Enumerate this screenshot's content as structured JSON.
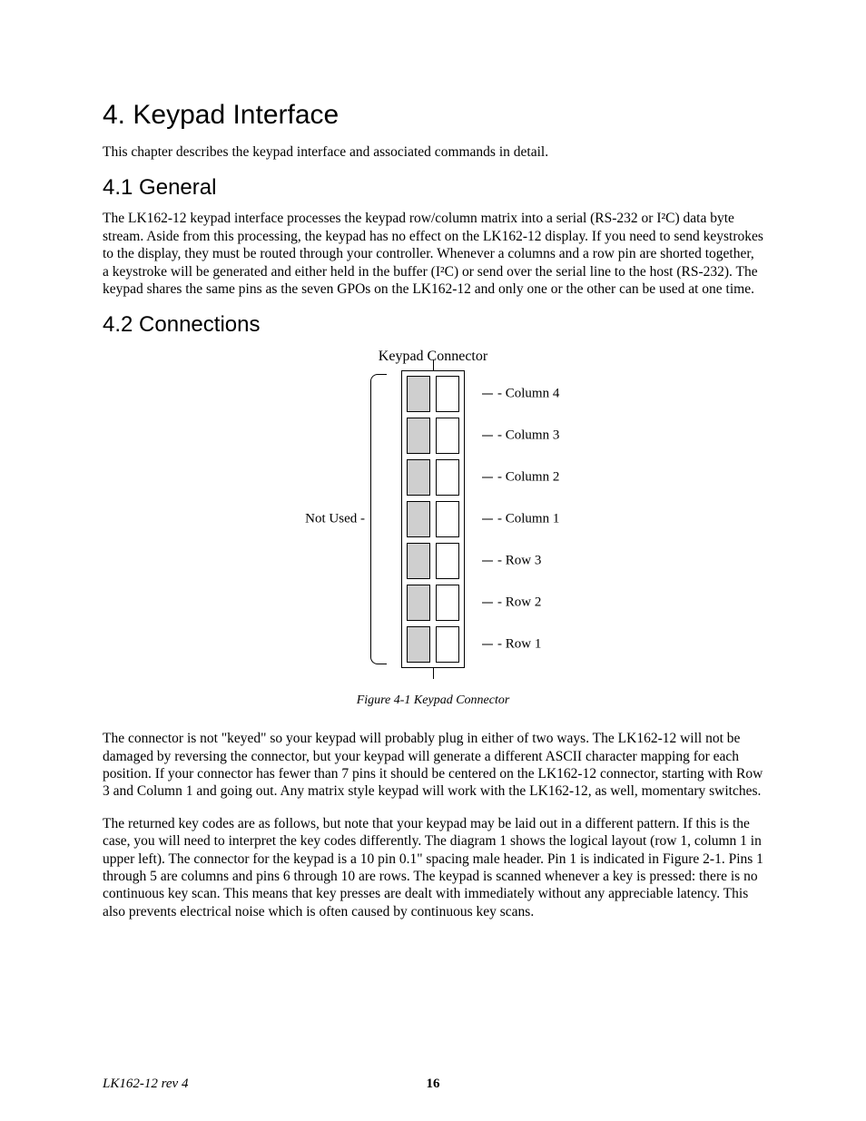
{
  "chapter": {
    "number": "4.",
    "title": "Keypad Interface"
  },
  "intro": "This chapter describes the keypad interface and associated commands in detail.",
  "sections": {
    "s41": {
      "number": "4.1",
      "title": "General"
    },
    "s42": {
      "number": "4.2",
      "title": "Connections"
    }
  },
  "general_text": "The LK162-12 keypad interface processes the keypad row/column matrix into a serial (RS-232 or I²C) data byte stream. Aside from this processing, the keypad has no effect on the LK162-12 display. If you need to send keystrokes to the display, they must be routed through your controller. Whenever a columns and a row pin are shorted together, a keystroke will be generated and either held in the buffer (I²C) or send over the serial line to the host (RS-232). The keypad shares the same pins as the seven GPOs on the LK162-12 and only one or the other can be used at one time.",
  "diagram": {
    "title": "Keypad Connector",
    "left_label": "Not Used -",
    "pins": [
      {
        "label": "Column 4"
      },
      {
        "label": "Column 3"
      },
      {
        "label": "Column 2"
      },
      {
        "label": "Column 1"
      },
      {
        "label": "Row 3"
      },
      {
        "label": "Row 2"
      },
      {
        "label": "Row 1"
      }
    ]
  },
  "figure_caption": "Figure 4-1 Keypad Connector",
  "para2": "The connector is not \"keyed\" so your keypad will probably plug in either of two ways. The LK162-12 will not be damaged by reversing the connector, but your keypad will generate a different ASCII character mapping for each position. If your connector has fewer than 7 pins it should be centered on the LK162-12 connector, starting with Row 3 and Column 1 and going out. Any matrix style keypad will work with the LK162-12, as well, momentary switches.",
  "para3": "The returned key codes are as follows, but note that your keypad may be laid out in a different pattern. If this is the case, you will need to interpret the key codes differently. The diagram 1 shows the logical layout (row 1, column 1 in upper left). The connector for the keypad is a 10 pin 0.1\" spacing male header. Pin 1 is indicated in Figure 2-1. Pins 1 through 5 are columns and pins 6 through 10 are rows. The keypad is scanned whenever a key is pressed: there is no continuous key scan. This means that key presses are dealt with immediately without any appreciable latency. This also prevents electrical noise which is often caused by continuous key scans.",
  "footer": {
    "left": "LK162-12 rev 4",
    "page": "16"
  }
}
